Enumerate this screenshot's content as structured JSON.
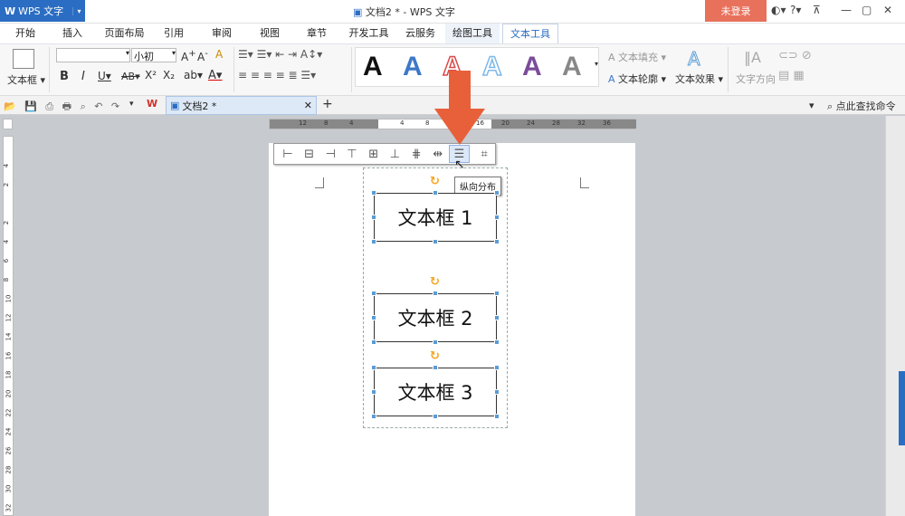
{
  "app": {
    "name": "WPS 文字",
    "title": "文档2 * - WPS 文字",
    "login": "未登录"
  },
  "menu": [
    "开始",
    "插入",
    "页面布局",
    "引用",
    "审阅",
    "视图",
    "章节",
    "开发工具",
    "云服务",
    "绘图工具",
    "文本工具"
  ],
  "ribbon": {
    "textbox_label": "文本框",
    "font_size": "小初",
    "text_fill": "文本填充",
    "text_outline": "文本轮廓",
    "text_effect": "文本效果",
    "text_direction": "文字方向"
  },
  "doc_tab": {
    "name": "文档2 *"
  },
  "search_cmd": "点此查找命令",
  "ruler_h": [
    "12",
    "8",
    "4",
    "",
    "4",
    "8",
    "12",
    "16",
    "20",
    "24",
    "28",
    "32",
    "36"
  ],
  "ruler_v": [
    "4",
    "2",
    "",
    "2",
    "4",
    "6",
    "8",
    "10",
    "12",
    "14",
    "16",
    "18",
    "20",
    "22",
    "24",
    "26",
    "28",
    "30",
    "32"
  ],
  "tooltip": "纵向分布",
  "textboxes": [
    "文本框 1",
    "文本框 2",
    "文本框 3"
  ],
  "colors": {
    "accent": "#2b6dc3",
    "login": "#e8715c",
    "arrow": "#e8603a",
    "handle": "#5b9bd5"
  }
}
